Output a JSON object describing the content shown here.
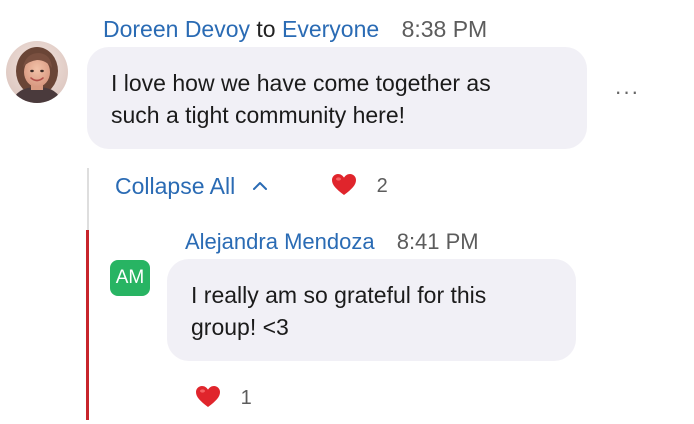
{
  "message1": {
    "sender": "Doreen Devoy",
    "to_word": "to",
    "recipient": "Everyone",
    "time": "8:38 PM",
    "line1": "I love how we have come together as",
    "line2": "such a tight community here!",
    "more_label": "···"
  },
  "thread": {
    "collapse_label": "Collapse All",
    "reaction_count": "2"
  },
  "message2": {
    "sender": "Alejandra Mendoza",
    "time": "8:41 PM",
    "initials": "AM",
    "line1": "I really am so grateful for this",
    "line2": "group! <3",
    "reaction_count": "1"
  },
  "colors": {
    "name_blue": "#2a6bb4",
    "bubble_bg": "#f1f0f6",
    "thread_red": "#c7242b",
    "avatar_green": "#28b463",
    "heart_red": "#e0252c"
  }
}
